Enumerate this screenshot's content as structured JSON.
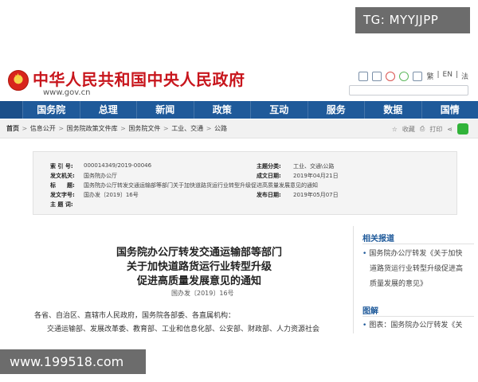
{
  "watermarks": {
    "top": "TG: MYYJJPP",
    "bottom": "www.199518.com"
  },
  "header": {
    "site_title": "中华人民共和国中央人民政府",
    "site_url": "www.gov.cn",
    "languages": [
      "繁",
      "EN",
      "法"
    ]
  },
  "nav": {
    "items": [
      "国务院",
      "总理",
      "新闻",
      "政策",
      "互动",
      "服务",
      "数据",
      "国情"
    ]
  },
  "breadcrumb": {
    "items": [
      "首页",
      "信息公开",
      "国务院政策文件库",
      "国务院文件",
      "工业、交通",
      "公路"
    ],
    "actions": {
      "collect": "收藏",
      "print": "打印"
    }
  },
  "meta": {
    "index_no_label": "索 引 号:",
    "index_no": "000014349/2019-00046",
    "category_label": "主题分类:",
    "category": "工业、交通\\公路",
    "issuer_label": "发文机关:",
    "issuer": "国务院办公厅",
    "created_label": "成文日期:",
    "created": "2019年04月21日",
    "title_label": "标　　题:",
    "title": "国务院办公厅转发交通运输部等部门关于加快道路货运行业转型升级促进高质量发展意见的通知",
    "doc_no_label": "发文字号:",
    "doc_no": "国办发〔2019〕16号",
    "published_label": "发布日期:",
    "published": "2019年05月07日",
    "keywords_label": "主 题 词:",
    "keywords": ""
  },
  "article": {
    "title_line1": "国务院办公厅转发交通运输部等部门",
    "title_line2": "关于加快道路货运行业转型升级",
    "title_line3": "促进高质量发展意见的通知",
    "doc_number": "国办发〔2019〕16号",
    "para1": "各省、自治区、直辖市人民政府，国务院各部委、各直属机构：",
    "para2": "交通运输部、发展改革委、教育部、工业和信息化部、公安部、财政部、人力资源社会"
  },
  "sidebar": {
    "related_head": "相关报道",
    "related_lines": [
      "国务院办公厅转发《关于加快",
      "道路货运行业转型升级促进高",
      "质量发展的意见》"
    ],
    "graphic_head": "图解",
    "graphic_line": "图表：国务院办公厅转发《关"
  }
}
